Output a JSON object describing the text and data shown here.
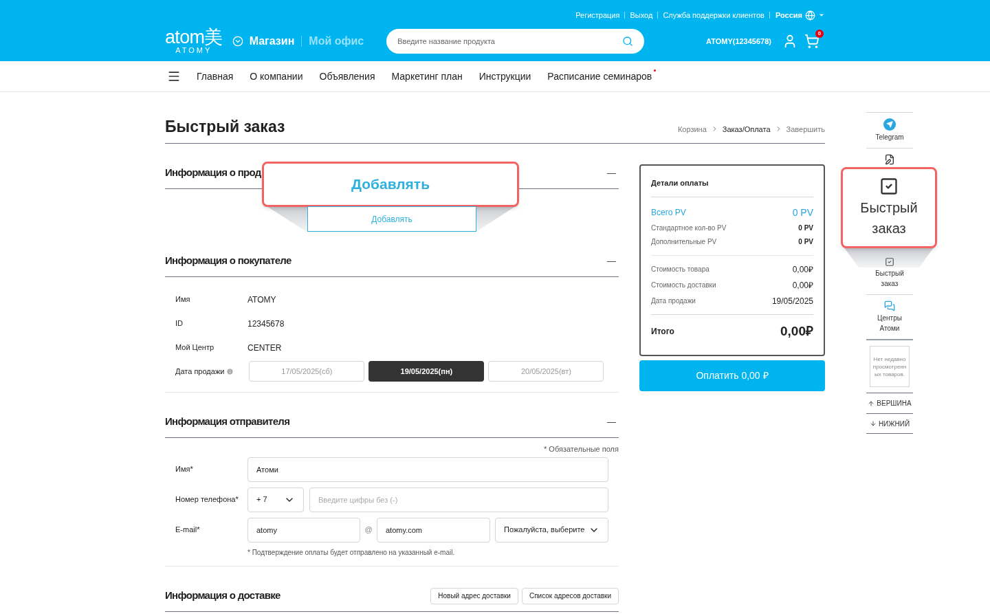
{
  "header": {
    "top_links": [
      "Регистрация",
      "Выход",
      "Служба поддержки клиентов"
    ],
    "country": "Россия",
    "logo": {
      "mark": "atom美",
      "word": "ATOMY"
    },
    "tabs": [
      {
        "label": "Магазин",
        "selected": true
      },
      {
        "label": "Мой офис",
        "selected": false
      }
    ],
    "search": {
      "placeholder": "Введите название продукта"
    },
    "user": "ATOMY(12345678)",
    "cart_count": "0"
  },
  "nav": {
    "items": [
      {
        "label": "Главная",
        "dot": false
      },
      {
        "label": "О компании",
        "dot": false
      },
      {
        "label": "Объявления",
        "dot": false
      },
      {
        "label": "Маркетинг план",
        "dot": false
      },
      {
        "label": "Инструкции",
        "dot": false
      },
      {
        "label": "Расписание семинаров",
        "dot": true
      }
    ]
  },
  "page": {
    "title": "Быстрый заказ",
    "breadcrumb": [
      {
        "label": "Корзина",
        "selected": false
      },
      {
        "label": "Заказ/Оплата",
        "selected": true
      },
      {
        "label": "Завершить",
        "selected": false
      }
    ]
  },
  "product_section": {
    "title": "Информация о прод",
    "toggle": "—",
    "add_button": "Добавлять"
  },
  "buyer_section": {
    "title": "Информация о покупателе",
    "toggle": "—",
    "fields": [
      {
        "label": "Имя",
        "value": "ATOMY"
      },
      {
        "label": "ID",
        "value": "12345678"
      },
      {
        "label": "Мой Центр",
        "value": "CENTER"
      }
    ],
    "date_label": "Дата продажи",
    "dates": [
      {
        "label": "17/05/2025(сб)",
        "selected": false
      },
      {
        "label": "19/05/2025(пн)",
        "selected": true
      },
      {
        "label": "20/05/2025(вт)",
        "selected": false
      }
    ]
  },
  "sender_section": {
    "title": "Информация отправителя",
    "toggle": "—",
    "required_note": "* Обязательные поля",
    "name": {
      "label": "Имя*",
      "value": "Атоми"
    },
    "phone": {
      "label": "Номер телефона*",
      "code": "+ 7",
      "placeholder": "Введите цифры без (-)"
    },
    "email": {
      "label": "E-mail*",
      "user": "atomy",
      "at": "@",
      "domain": "atomy.com",
      "select": "Пожалуйста, выберите",
      "note": "* Подтверждение оплаты будет отправлено на указанный e-mail."
    }
  },
  "delivery_section": {
    "title": "Информация о доставке",
    "buttons": [
      "Новый адрес доставки",
      "Список адресов доставки"
    ]
  },
  "payment": {
    "title": "Детали оплаты",
    "pv_rows": [
      {
        "kind": "total",
        "label": "Всего PV",
        "value": "0 PV"
      },
      {
        "kind": "plain",
        "label": "Стандартное кол-во PV",
        "value": "0 PV"
      },
      {
        "kind": "plain",
        "label": "Дополнительные PV",
        "value": "0 PV"
      }
    ],
    "cost_rows": [
      {
        "label": "Стоимость товара",
        "value": "0,00₽"
      },
      {
        "label": "Стоимость доставки",
        "value": "0,00₽"
      },
      {
        "label": "Дата продажи",
        "value": "19/05/2025"
      }
    ],
    "total": {
      "label": "Итого",
      "value": "0,00₽"
    },
    "pay_button": "Оплатить 0,00 ₽"
  },
  "quick_menu": {
    "items": [
      {
        "kind": "telegram",
        "label": "Telegram"
      },
      {
        "kind": "note"
      },
      {
        "kind": "quick",
        "label": "Быстрый заказ"
      },
      {
        "kind": "centers",
        "label": "Центры Атоми"
      }
    ],
    "recent": "Нет недавно просмотренных товаров.",
    "top": "ВЕРШИНА",
    "bottom": "НИЖНИЙ"
  },
  "callouts": [
    {
      "kind": "add",
      "text": "Добавлять"
    },
    {
      "kind": "quick",
      "text": "Быстрый заказ"
    }
  ]
}
